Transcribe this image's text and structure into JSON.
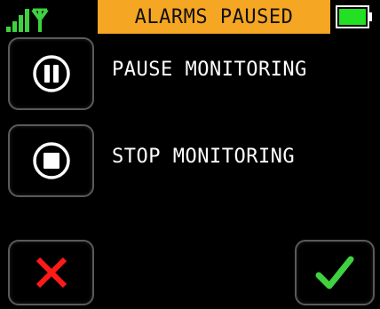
{
  "status_bar": {
    "banner_text": "ALARMS PAUSED",
    "signal_icon": "signal-bars-antenna-icon",
    "battery_icon": "battery-full-icon",
    "banner_color": "#f5a623",
    "signal_color": "#3fd13f",
    "battery_color": "#22e022"
  },
  "actions": [
    {
      "label": "PAUSE MONITORING",
      "icon": "pause-circle-icon"
    },
    {
      "label": "STOP MONITORING",
      "icon": "stop-circle-icon"
    }
  ],
  "footer": {
    "cancel_icon": "close-icon",
    "cancel_color": "#ff1a1a",
    "confirm_icon": "checkmark-icon",
    "confirm_color": "#3fd13f"
  }
}
